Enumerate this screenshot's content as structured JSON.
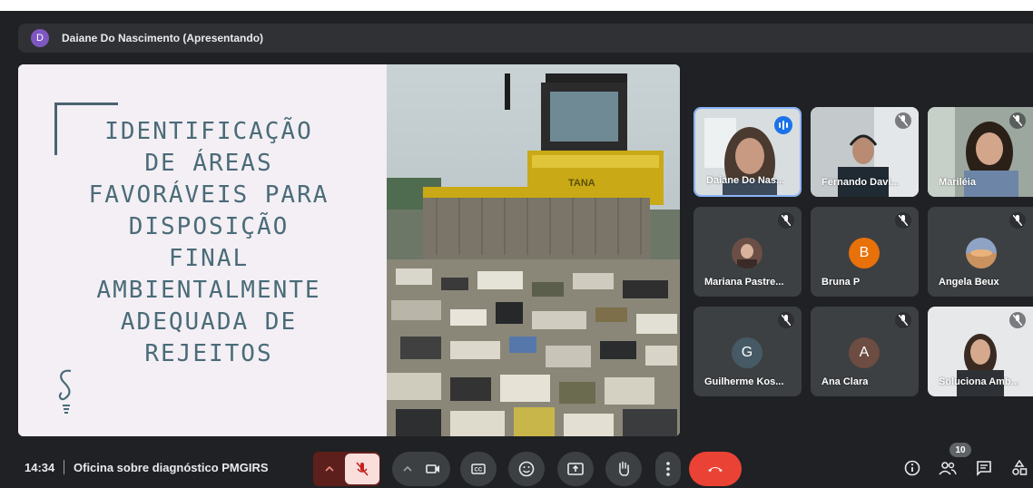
{
  "presenter": {
    "initial": "D",
    "label": "Daiane Do Nascimento (Apresentando)"
  },
  "slide": {
    "title_lines": [
      "IDENTIFICAÇÃO",
      "DE ÁREAS",
      "FAVORÁVEIS PARA",
      "DISPOSIÇÃO",
      "FINAL",
      "AMBIENTALMENTE",
      "ADEQUADA DE",
      "REJEITOS"
    ],
    "machine_brand": "TANA"
  },
  "participants": [
    {
      "name": "Daiane Do Nas...",
      "kind": "video",
      "speaking": true
    },
    {
      "name": "Fernando Davi...",
      "kind": "video",
      "muted": true
    },
    {
      "name": "Mariléia",
      "kind": "video",
      "muted": true
    },
    {
      "name": "Mariana Pastre...",
      "kind": "photo",
      "muted": true
    },
    {
      "name": "Bruna P",
      "kind": "letter",
      "initial": "B",
      "color": "#e8710a",
      "muted": true
    },
    {
      "name": "Angela Beux",
      "kind": "photo",
      "muted": true
    },
    {
      "name": "Guilherme Kos...",
      "kind": "letter",
      "initial": "G",
      "color": "#455a64",
      "muted": true
    },
    {
      "name": "Ana Clara",
      "kind": "letter",
      "initial": "A",
      "color": "#6d4c41",
      "muted": true
    },
    {
      "name": "Soluciona Amb...",
      "kind": "video",
      "muted": true
    }
  ],
  "bottom": {
    "time": "14:34",
    "separator": "|",
    "meeting_title": "Oficina sobre diagnóstico PMGIRS",
    "participant_count": "10"
  },
  "colors": {
    "background": "#202124",
    "tile": "#3c4043",
    "end_call": "#ea4335",
    "mic_muted_bg": "#f9dedc",
    "speaking": "#1a73e8"
  },
  "icons": {
    "mic": "mic-off-icon",
    "camera": "camera-icon",
    "captions": "captions-icon",
    "emoji": "emoji-icon",
    "present": "present-icon",
    "hand": "raise-hand-icon",
    "more": "more-options-icon",
    "end": "end-call-icon",
    "info": "info-icon",
    "people": "people-icon",
    "chat": "chat-icon",
    "activities": "activities-icon"
  }
}
